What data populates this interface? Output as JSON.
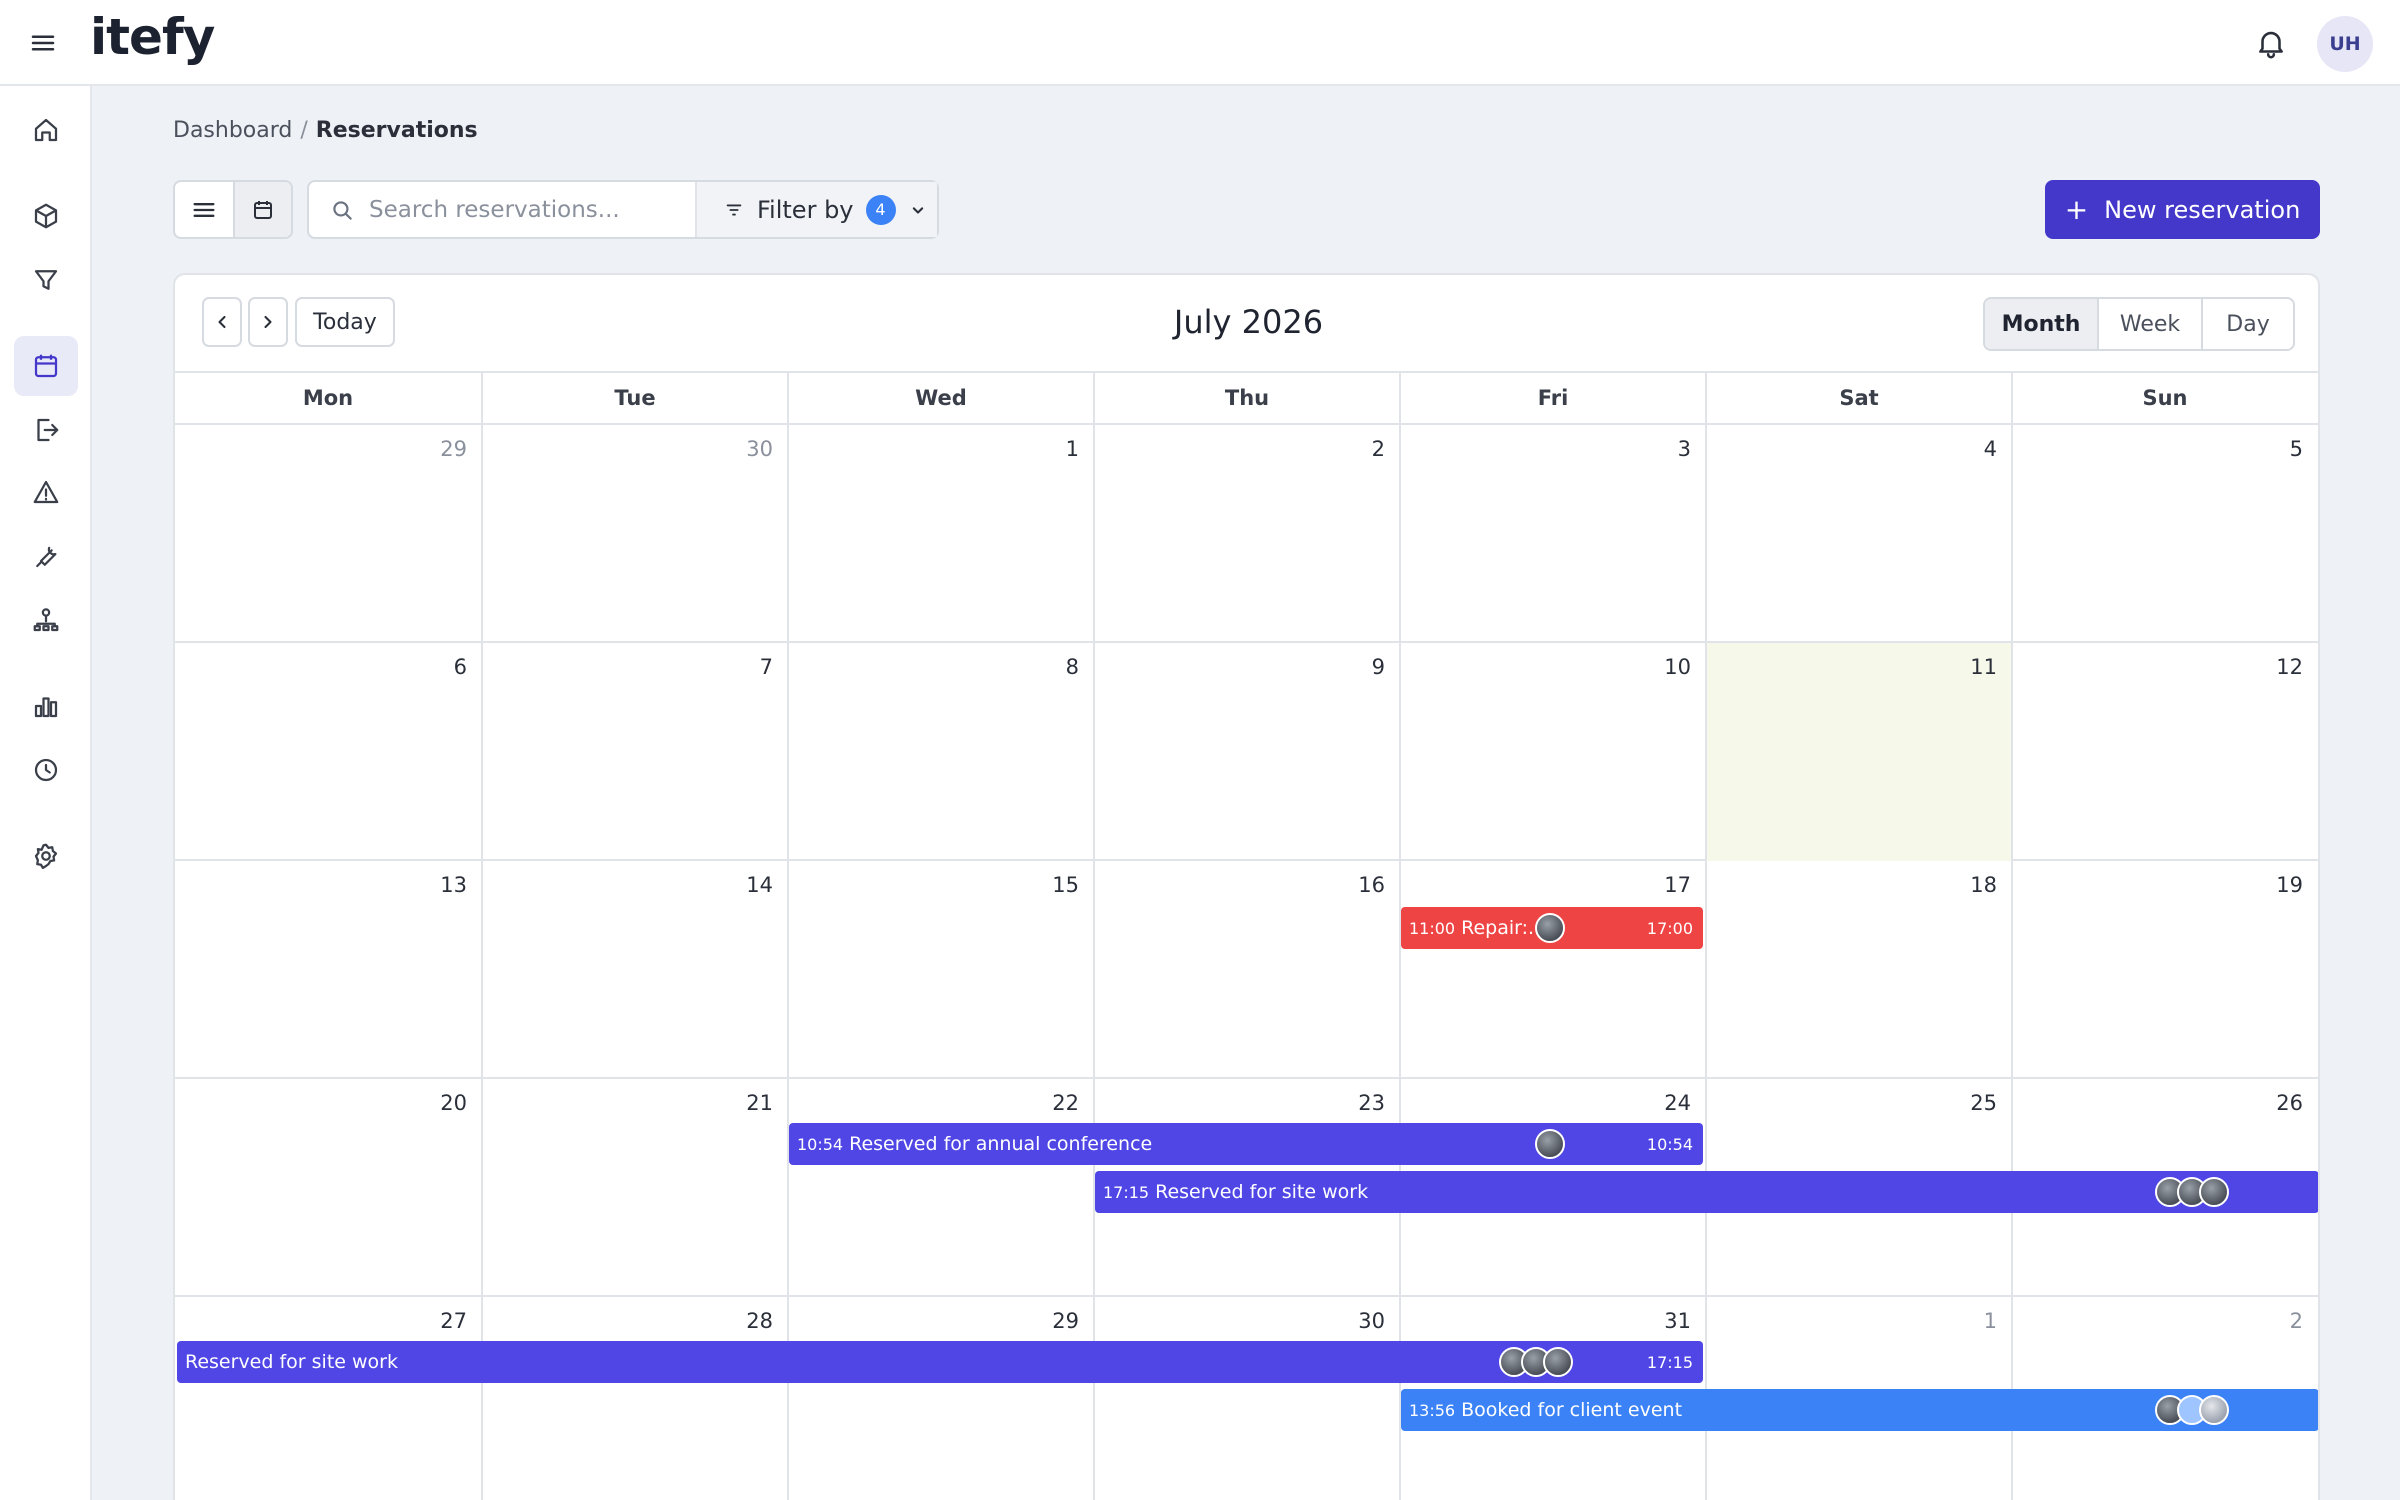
{
  "app": {
    "logo": "itefy",
    "user_initials": "UH"
  },
  "breadcrumb": {
    "parent": "Dashboard",
    "separator": "/",
    "current": "Reservations"
  },
  "toolbar": {
    "search_placeholder": "Search reservations...",
    "filter_label": "Filter by",
    "filter_count": "4",
    "new_button": "New reservation"
  },
  "calendar": {
    "title": "July 2026",
    "today_label": "Today",
    "views": [
      "Month",
      "Week",
      "Day"
    ],
    "selected_view": "Month",
    "weekdays": [
      "Mon",
      "Tue",
      "Wed",
      "Thu",
      "Fri",
      "Sat",
      "Sun"
    ],
    "weeks": [
      [
        "29",
        "30",
        "1",
        "2",
        "3",
        "4",
        "5"
      ],
      [
        "6",
        "7",
        "8",
        "9",
        "10",
        "11",
        "12"
      ],
      [
        "13",
        "14",
        "15",
        "16",
        "17",
        "18",
        "19"
      ],
      [
        "20",
        "21",
        "22",
        "23",
        "24",
        "25",
        "26"
      ],
      [
        "27",
        "28",
        "29",
        "30",
        "31",
        "1",
        "2"
      ]
    ],
    "events": {
      "repair": {
        "start": "11:00",
        "label": "Repair:...",
        "end": "17:00",
        "color": "#ef4444"
      },
      "conference": {
        "start": "10:54",
        "label": "Reserved for annual conference",
        "end": "10:54",
        "color": "#4f46e5"
      },
      "sitework_a": {
        "start": "17:15",
        "label": "Reserved for site work",
        "color": "#4f46e5"
      },
      "sitework_b": {
        "label": "Reserved for site work",
        "end": "17:15",
        "color": "#4f46e5"
      },
      "client": {
        "start": "13:56",
        "label": "Booked for client event",
        "color": "#3b82f6"
      }
    }
  },
  "sidebar": {
    "icons": [
      "home-icon",
      "box-icon",
      "filter-icon",
      "calendar-icon",
      "checkout-icon",
      "alert-icon",
      "wrench-icon",
      "org-chart-icon",
      "bar-chart-icon",
      "history-icon",
      "settings-icon"
    ],
    "active": "calendar-icon"
  }
}
